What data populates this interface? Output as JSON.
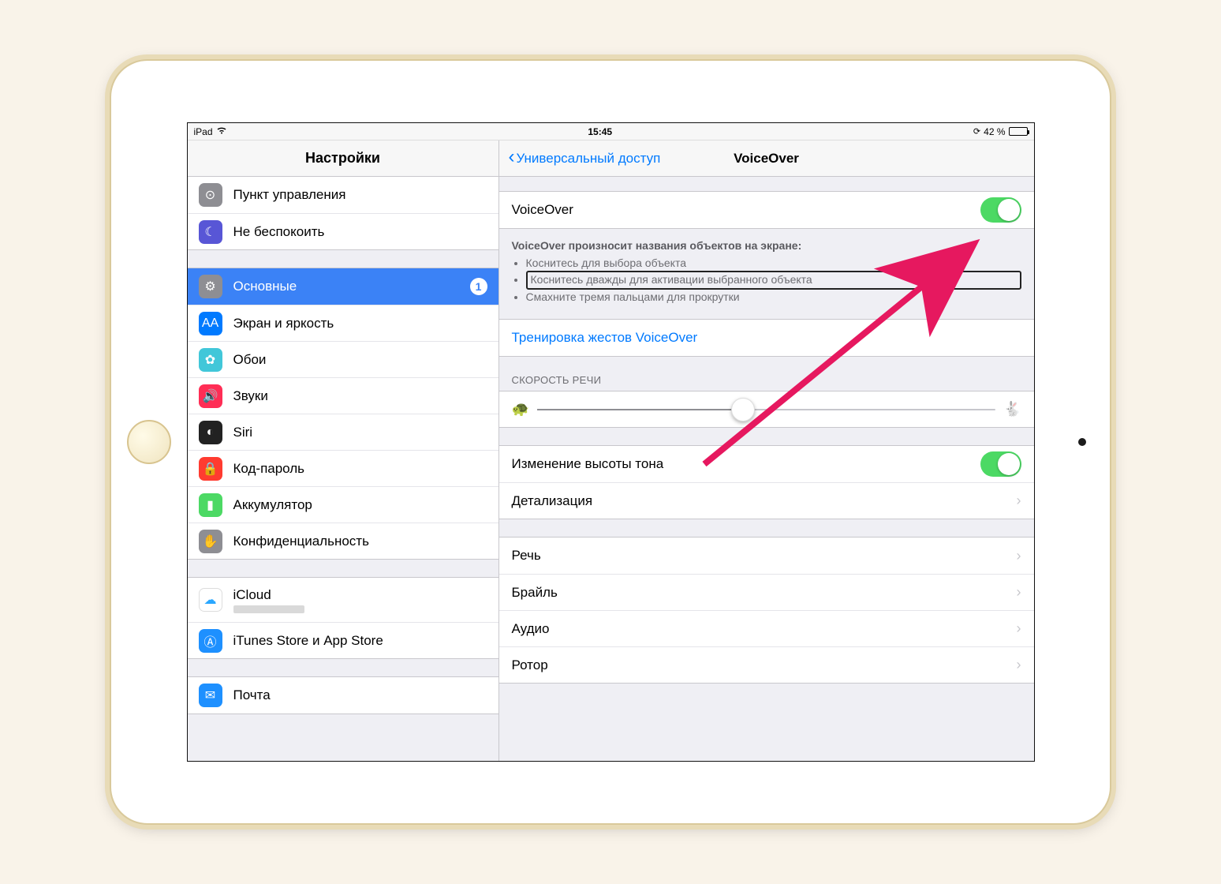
{
  "statusbar": {
    "device": "iPad",
    "time": "15:45",
    "battery_text": "42 %",
    "battery_pct": 42
  },
  "sidebar": {
    "title": "Настройки",
    "group1": [
      {
        "label": "Пункт управления",
        "iconBg": "#8e8e93",
        "glyph": "⊙"
      },
      {
        "label": "Не беспокоить",
        "iconBg": "#5856d6",
        "glyph": "☾"
      }
    ],
    "group2": [
      {
        "label": "Основные",
        "iconBg": "#8e8e93",
        "glyph": "⚙",
        "selected": true,
        "badge": "1"
      },
      {
        "label": "Экран и яркость",
        "iconBg": "#007aff",
        "glyph": "AA"
      },
      {
        "label": "Обои",
        "iconBg": "#41c7d9",
        "glyph": "✿"
      },
      {
        "label": "Звуки",
        "iconBg": "#ff2d55",
        "glyph": "🔊"
      },
      {
        "label": "Siri",
        "iconBg": "#222",
        "glyph": "◐"
      },
      {
        "label": "Код-пароль",
        "iconBg": "#ff3b30",
        "glyph": "🔒"
      },
      {
        "label": "Аккумулятор",
        "iconBg": "#4cd964",
        "glyph": "▮"
      },
      {
        "label": "Конфиденциальность",
        "iconBg": "#8e8e93",
        "glyph": "✋"
      }
    ],
    "group3": [
      {
        "label": "iCloud",
        "iconBg": "#ffffff",
        "glyph": "☁",
        "sub": true
      },
      {
        "label": "iTunes Store и App Store",
        "iconBg": "#1e90ff",
        "glyph": "Ⓐ"
      }
    ],
    "group4": [
      {
        "label": "Почта",
        "iconBg": "#1e90ff",
        "glyph": "✉"
      }
    ]
  },
  "detail": {
    "back_label": "Универсальный доступ",
    "title": "VoiceOver",
    "voiceover_row": "VoiceOver",
    "voiceover_on": true,
    "desc_title": "VoiceOver произносит названия объектов на экране:",
    "desc_items": [
      "Коснитесь для выбора объекта",
      "Коснитесь дважды для активации выбранного объекта",
      "Смахните тремя пальцами для прокрутки"
    ],
    "practice_label": "Тренировка жестов VoiceOver",
    "speed_section": "СКОРОСТЬ РЕЧИ",
    "speed_pct": 45,
    "pitch_row": "Изменение высоты тона",
    "pitch_on": true,
    "verbosity_row": "Детализация",
    "group_more": [
      "Речь",
      "Брайль",
      "Аудио",
      "Ротор"
    ]
  }
}
